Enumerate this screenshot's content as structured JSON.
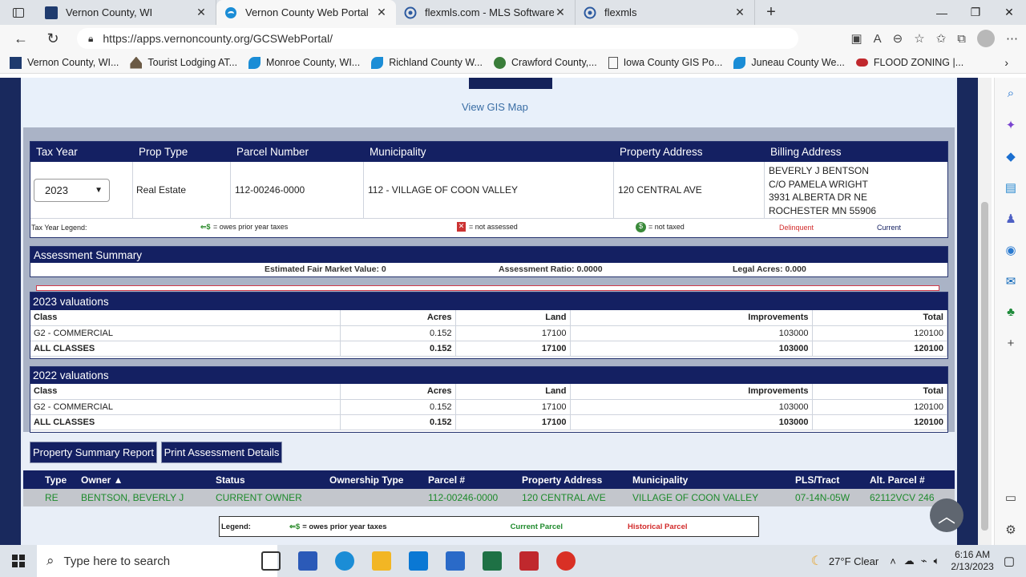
{
  "browser": {
    "tabs": [
      {
        "title": "Vernon County, WI",
        "icon": "county-seal-icon",
        "active": false
      },
      {
        "title": "Vernon County Web Portal",
        "icon": "edge-icon",
        "active": true
      },
      {
        "title": "flexmls.com - MLS Software for R",
        "icon": "flexmls-icon",
        "active": false
      },
      {
        "title": "flexmls",
        "icon": "flexmls-icon",
        "active": false
      }
    ],
    "url": "https://apps.vernoncounty.org/GCSWebPortal/",
    "favorites": [
      "Vernon County, WI...",
      "Tourist Lodging AT...",
      "Monroe County, WI...",
      "Richland County W...",
      "Crawford County,...",
      "Iowa County GIS Po...",
      "Juneau County We...",
      "FLOOD ZONING |..."
    ]
  },
  "page": {
    "gis_link": "View GIS Map",
    "parcel_header": [
      "Tax Year",
      "Prop Type",
      "Parcel Number",
      "Municipality",
      "Property Address",
      "Billing Address"
    ],
    "parcel": {
      "tax_year": "2023",
      "prop_type": "Real Estate",
      "parcel_number": "112-00246-0000",
      "municipality": "112 - VILLAGE OF COON VALLEY",
      "property_address": "120 CENTRAL AVE",
      "billing": [
        "BEVERLY J BENTSON",
        "C/O PAMELA WRIGHT",
        "3931 ALBERTA DR NE",
        "ROCHESTER MN 55906"
      ]
    },
    "legend": {
      "title": "Tax Year Legend:",
      "owes": "= owes prior year taxes",
      "not_assessed": "= not assessed",
      "not_taxed": "= not taxed",
      "delinquent": "Delinquent",
      "current": "Current"
    },
    "assessment": {
      "title": "Assessment Summary",
      "fair_market": "Estimated Fair Market Value: 0",
      "ratio": "Assessment Ratio: 0.0000",
      "acres": "Legal Acres: 0.000"
    },
    "valuations": [
      {
        "title": "2023 valuations",
        "headers": [
          "Class",
          "Acres",
          "Land",
          "Improvements",
          "Total"
        ],
        "rows": [
          [
            "G2 - COMMERCIAL",
            "0.152",
            "17100",
            "103000",
            "120100"
          ],
          [
            "ALL CLASSES",
            "0.152",
            "17100",
            "103000",
            "120100"
          ]
        ]
      },
      {
        "title": "2022 valuations",
        "headers": [
          "Class",
          "Acres",
          "Land",
          "Improvements",
          "Total"
        ],
        "rows": [
          [
            "G2 - COMMERCIAL",
            "0.152",
            "17100",
            "103000",
            "120100"
          ],
          [
            "ALL CLASSES",
            "0.152",
            "17100",
            "103000",
            "120100"
          ]
        ]
      }
    ],
    "buttons": {
      "summary": "Property Summary Report",
      "print": "Print Assessment Details"
    },
    "owners": {
      "headers": [
        "Type",
        "Owner ▲",
        "Status",
        "Ownership Type",
        "Parcel #",
        "Property Address",
        "Municipality",
        "PLS/Tract",
        "Alt. Parcel #"
      ],
      "row": [
        "RE",
        "BENTSON, BEVERLY J",
        "CURRENT OWNER",
        "",
        "112-00246-0000",
        "120 CENTRAL AVE",
        "VILLAGE OF COON VALLEY",
        "07-14N-05W",
        "62112VCV 246"
      ]
    },
    "owner_legend": {
      "title": "Legend:",
      "owes": "= owes prior year taxes",
      "current": "Current Parcel",
      "historical": "Historical Parcel"
    }
  },
  "taskbar": {
    "search_placeholder": "Type here to search",
    "weather": "27°F  Clear",
    "time": "6:16 AM",
    "date": "2/13/2023"
  },
  "colors": {
    "navy": "#142062",
    "green": "#1e8a2c",
    "red": "#d22b2b",
    "link": "#3a6ea5"
  }
}
